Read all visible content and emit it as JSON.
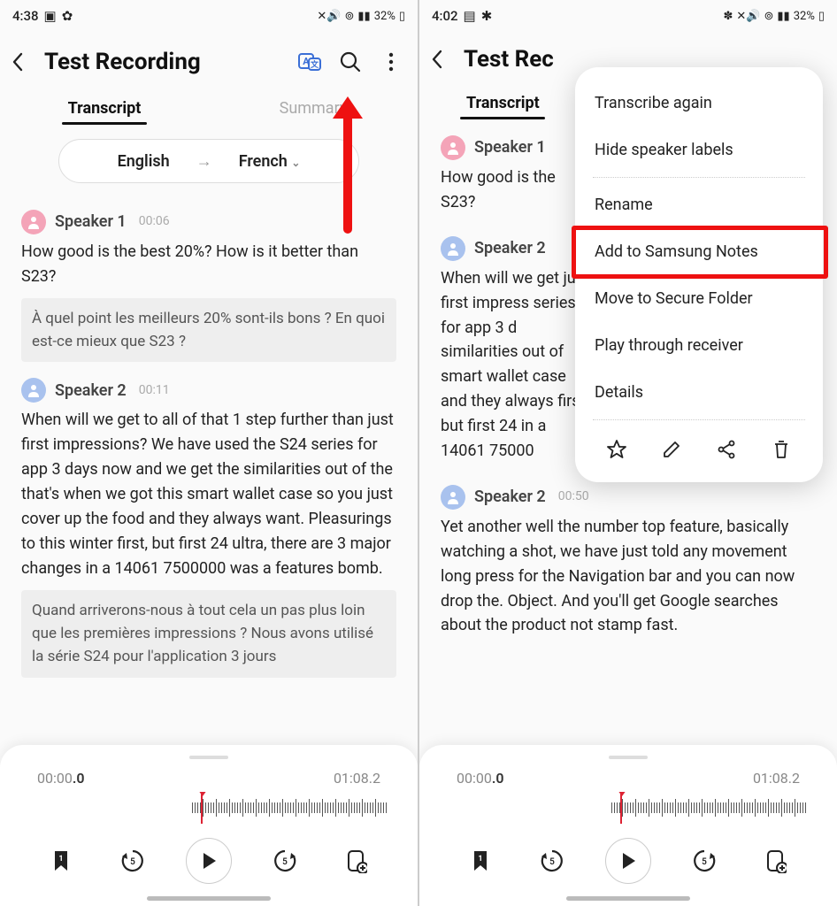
{
  "left": {
    "status": {
      "time": "4:38",
      "battery": "32%"
    },
    "title": "Test Recording",
    "tabs": {
      "transcript": "Transcript",
      "summary": "Summary"
    },
    "lang": {
      "from": "English",
      "to": "French"
    },
    "seg1": {
      "speaker": "Speaker 1",
      "time": "00:06",
      "text": "How good is the best 20%? How is it better than S23?",
      "translation": "À quel point les meilleurs 20% sont-ils bons ? En quoi est-ce mieux que S23 ?"
    },
    "seg2": {
      "speaker": "Speaker 2",
      "time": "00:11",
      "text": "When will we get to all of that 1 step further than just first impressions? We have used the S24 series for app 3 days now and we get the similarities out of the that's when we got this smart wallet case so you just cover up the food and they always want. Pleasurings to this winter first, but first 24 ultra, there are 3 major changes in a 14061 7500000 was a features bomb.",
      "translation": "Quand arriverons-nous à tout cela un pas plus loin que les premières impressions ? Nous avons utilisé la série S24 pour l'application 3 jours"
    },
    "player": {
      "current": "00:00",
      "current_frac": ".0",
      "total": "01:08.2"
    }
  },
  "right": {
    "status": {
      "time": "4:02",
      "battery": "32%"
    },
    "title": "Test Rec",
    "tabs": {
      "transcript": "Transcript"
    },
    "seg1": {
      "speaker": "Speaker 1",
      "time": "",
      "text": "How good is the S23?"
    },
    "seg2": {
      "speaker": "Speaker 2",
      "time": "",
      "text": "When will we get just first impress series for app 3 d similarities out of smart wallet case and they always first, but first 24 in a 14061 75000"
    },
    "seg3": {
      "speaker": "Speaker 2",
      "time": "00:50",
      "text": "Yet another well the number top feature, basically watching a shot, we have just told any movement long press for the Navigation bar and you can now drop the. Object. And you'll get Google searches about the product not stamp fast."
    },
    "player": {
      "current": "00:00",
      "current_frac": ".0",
      "total": "01:08.2"
    },
    "menu": {
      "items": [
        "Transcribe again",
        "Hide speaker labels",
        "Rename",
        "Add to Samsung Notes",
        "Move to Secure Folder",
        "Play through receiver",
        "Details"
      ]
    }
  }
}
